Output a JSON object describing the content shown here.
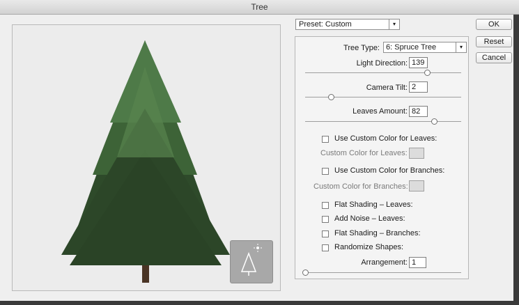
{
  "window": {
    "title": "Tree"
  },
  "preset": {
    "value": "Preset: Custom"
  },
  "buttons": {
    "ok": "OK",
    "reset": "Reset",
    "cancel": "Cancel"
  },
  "settings": {
    "tree_type_label": "Tree Type:",
    "tree_type_value": "6: Spruce Tree",
    "light_direction_label": "Light Direction:",
    "light_direction_value": "139",
    "camera_tilt_label": "Camera Tilt:",
    "camera_tilt_value": "2",
    "leaves_amount_label": "Leaves Amount:",
    "leaves_amount_value": "82",
    "custom_color_leaves_checkbox": "Use Custom Color for Leaves:",
    "custom_color_leaves_label": "Custom Color for Leaves:",
    "custom_color_branches_checkbox": "Use Custom Color for Branches:",
    "custom_color_branches_label": "Custom Color for Branches:",
    "flat_shading_leaves": "Flat Shading – Leaves:",
    "add_noise_leaves": "Add Noise – Leaves:",
    "flat_shading_branches": "Flat Shading – Branches:",
    "randomize_shapes": "Randomize Shapes:",
    "arrangement_label": "Arrangement:",
    "arrangement_value": "1"
  },
  "icons": {
    "preset_arrow": "▾",
    "tree_type_arrow": "▾"
  },
  "colors": {
    "foliage_dark": "#2e4a2a",
    "foliage_light": "#4e7a48",
    "trunk": "#4a3424"
  }
}
